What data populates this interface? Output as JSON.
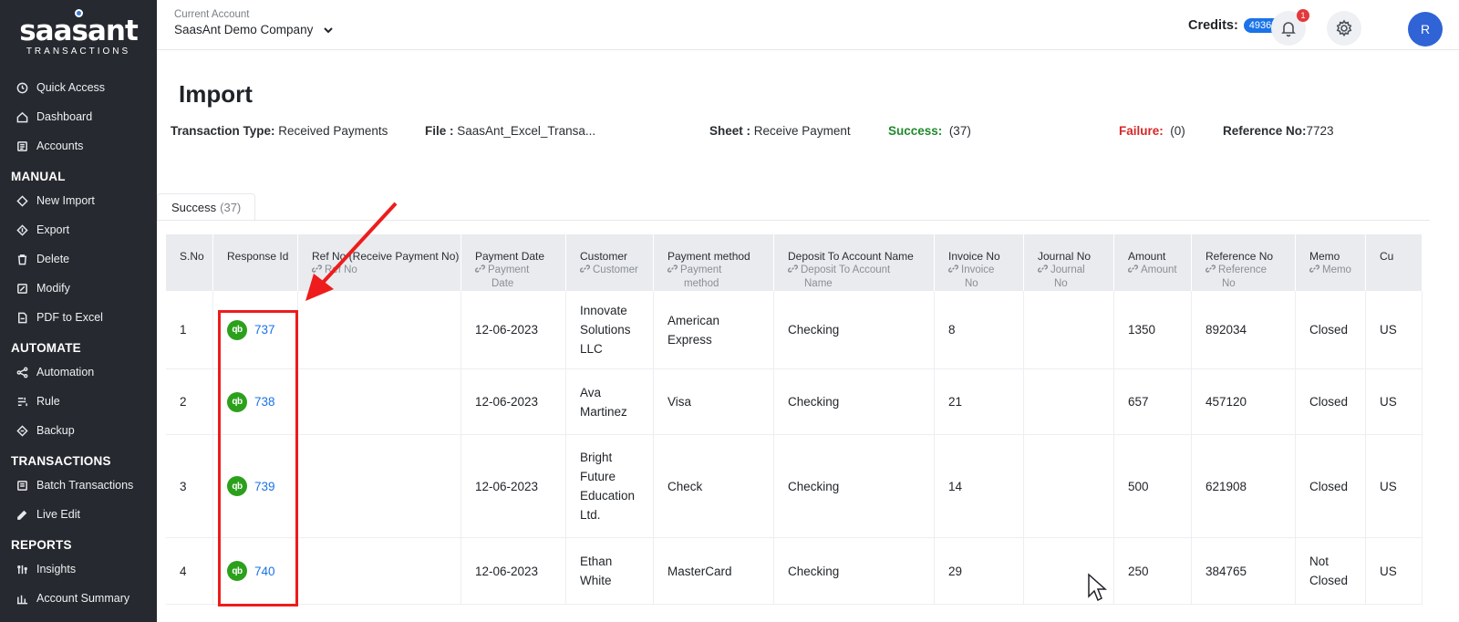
{
  "brand": {
    "name": "saasant",
    "tagline": "TRANSACTIONS"
  },
  "sidebar": {
    "top_items": [
      {
        "label": "Quick Access",
        "icon": "quick-access-icon"
      },
      {
        "label": "Dashboard",
        "icon": "home-icon"
      },
      {
        "label": "Accounts",
        "icon": "accounts-icon"
      }
    ],
    "sections": [
      {
        "title": "MANUAL",
        "items": [
          {
            "label": "New Import",
            "icon": "import-icon"
          },
          {
            "label": "Export",
            "icon": "export-icon"
          },
          {
            "label": "Delete",
            "icon": "trash-icon"
          },
          {
            "label": "Modify",
            "icon": "edit-icon"
          },
          {
            "label": "PDF to Excel",
            "icon": "pdf-icon"
          }
        ]
      },
      {
        "title": "AUTOMATE",
        "items": [
          {
            "label": "Automation",
            "icon": "automation-icon"
          },
          {
            "label": "Rule",
            "icon": "rule-icon"
          },
          {
            "label": "Backup",
            "icon": "backup-icon"
          }
        ]
      },
      {
        "title": "TRANSACTIONS",
        "items": [
          {
            "label": "Batch Transactions",
            "icon": "batch-icon"
          },
          {
            "label": "Live Edit",
            "icon": "live-edit-icon"
          }
        ]
      },
      {
        "title": "REPORTS",
        "items": [
          {
            "label": "Insights",
            "icon": "insights-icon"
          },
          {
            "label": "Account Summary",
            "icon": "summary-icon"
          }
        ]
      }
    ]
  },
  "header": {
    "account_label": "Current Account",
    "account_name": "SaasAnt Demo Company",
    "credits_label": "Credits:",
    "credits_value": "49368",
    "notification_count": "1",
    "avatar_initial": "R"
  },
  "page": {
    "title": "Import",
    "meta": {
      "transaction_type_label": "Transaction Type:",
      "transaction_type_value": "Received Payments",
      "file_label": "File :",
      "file_value": "SaasAnt_Excel_Transa...",
      "sheet_label": "Sheet :",
      "sheet_value": "Receive Payment",
      "success_label": "Success:",
      "success_value": "(37)",
      "failure_label": "Failure:",
      "failure_value": "(0)",
      "reference_label": "Reference No:",
      "reference_value": "7723"
    },
    "tab": {
      "label": "Success",
      "count": "(37)"
    }
  },
  "table": {
    "headers": [
      {
        "title": "S.No",
        "sub1": "",
        "sub2": ""
      },
      {
        "title": "Response Id",
        "sub1": "",
        "sub2": ""
      },
      {
        "title": "Ref No (Receive Payment No)",
        "sub1": "Ref No",
        "sub2": ""
      },
      {
        "title": "Payment Date",
        "sub1": "Payment",
        "sub2": "Date"
      },
      {
        "title": "Customer",
        "sub1": "Customer",
        "sub2": ""
      },
      {
        "title": "Payment method",
        "sub1": "Payment",
        "sub2": "method"
      },
      {
        "title": "Deposit To Account Name",
        "sub1": "Deposit To Account",
        "sub2": "Name"
      },
      {
        "title": "Invoice No",
        "sub1": "Invoice",
        "sub2": "No"
      },
      {
        "title": "Journal No",
        "sub1": "Journal",
        "sub2": "No"
      },
      {
        "title": "Amount",
        "sub1": "Amount",
        "sub2": ""
      },
      {
        "title": "Reference No",
        "sub1": "Reference",
        "sub2": "No"
      },
      {
        "title": "Memo",
        "sub1": "Memo",
        "sub2": ""
      },
      {
        "title": "Cu",
        "sub1": "",
        "sub2": ""
      }
    ],
    "rows": [
      {
        "sno": "1",
        "response_id": "737",
        "ref_no": "",
        "payment_date": "12-06-2023",
        "customer": [
          "Innovate",
          "Solutions",
          "LLC"
        ],
        "payment_method": [
          "American",
          "Express"
        ],
        "deposit_to": "Checking",
        "invoice_no": "8",
        "journal_no": "",
        "amount": "1350",
        "reference_no": "892034",
        "memo": [
          "Closed"
        ],
        "currency": "US"
      },
      {
        "sno": "2",
        "response_id": "738",
        "ref_no": "",
        "payment_date": "12-06-2023",
        "customer": [
          "Ava",
          "Martinez"
        ],
        "payment_method": [
          "Visa"
        ],
        "deposit_to": "Checking",
        "invoice_no": "21",
        "journal_no": "",
        "amount": "657",
        "reference_no": "457120",
        "memo": [
          "Closed"
        ],
        "currency": "US"
      },
      {
        "sno": "3",
        "response_id": "739",
        "ref_no": "",
        "payment_date": "12-06-2023",
        "customer": [
          "Bright",
          "Future",
          "Education",
          "Ltd."
        ],
        "payment_method": [
          "Check"
        ],
        "deposit_to": "Checking",
        "invoice_no": "14",
        "journal_no": "",
        "amount": "500",
        "reference_no": "621908",
        "memo": [
          "Closed"
        ],
        "currency": "US"
      },
      {
        "sno": "4",
        "response_id": "740",
        "ref_no": "",
        "payment_date": "12-06-2023",
        "customer": [
          "Ethan",
          "White"
        ],
        "payment_method": [
          "MasterCard"
        ],
        "deposit_to": "Checking",
        "invoice_no": "29",
        "journal_no": "",
        "amount": "250",
        "reference_no": "384765",
        "memo": [
          "Not",
          "Closed"
        ],
        "currency": "US"
      }
    ],
    "qb_badge": "qb"
  },
  "annotation": {
    "color": "#ee1c1c"
  },
  "colors": {
    "sidebar_bg": "#26292f",
    "accent": "#1a73e8",
    "success": "#1f8a2c",
    "failure": "#d62828",
    "qb_green": "#2ca01c"
  }
}
